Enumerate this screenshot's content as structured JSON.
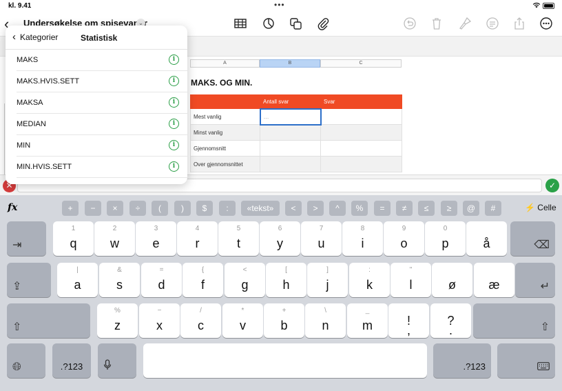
{
  "status": {
    "time": "kl. 9.41",
    "dots": "•••"
  },
  "toolbar": {
    "back_icon": "chevron-left-icon",
    "doc_title": "Undersøkelse om spisevaner",
    "title_chevron": "⌄",
    "icons": [
      "table-icon",
      "chart-icon",
      "shapes-icon",
      "paperclip-icon",
      "undo-icon",
      "delete-icon",
      "format-brush-icon",
      "comment-icon",
      "share-icon",
      "more-icon"
    ]
  },
  "popover": {
    "back_label": "Kategorier",
    "title": "Statistisk",
    "items": [
      "MAKS",
      "MAKS.HVIS.SETT",
      "MAKSA",
      "MEDIAN",
      "MIN",
      "MIN.HVIS.SETT"
    ]
  },
  "sheet": {
    "columns": [
      "A",
      "B",
      "C"
    ],
    "table_title": "MAKS. OG MIN.",
    "headers": [
      "",
      "Antall svar",
      "Svar"
    ],
    "rows": [
      {
        "label": "Mest vanlig",
        "b": "…",
        "c": ""
      },
      {
        "label": "Minst vanlig",
        "b": "",
        "c": ""
      },
      {
        "label": "Gjennomsnitt",
        "b": "",
        "c": ""
      },
      {
        "label": "Over gjennomsnittet",
        "b": "",
        "c": ""
      }
    ],
    "accent": "#f04a24"
  },
  "formula_bar": {
    "cancel": "✕",
    "ok": "✓"
  },
  "keyboard": {
    "fx": "fx",
    "symbols": [
      "+",
      "−",
      "×",
      "÷",
      "(",
      ")",
      "$",
      ":",
      "«tekst»",
      "<",
      ">",
      "^",
      "%",
      "=",
      "≠",
      "≤",
      "≥",
      "@",
      "#"
    ],
    "cell_label": "Celle",
    "row1": [
      {
        "sec": "1",
        "main": "q"
      },
      {
        "sec": "2",
        "main": "w"
      },
      {
        "sec": "3",
        "main": "e"
      },
      {
        "sec": "4",
        "main": "r"
      },
      {
        "sec": "5",
        "main": "t"
      },
      {
        "sec": "6",
        "main": "y"
      },
      {
        "sec": "7",
        "main": "u"
      },
      {
        "sec": "8",
        "main": "i"
      },
      {
        "sec": "9",
        "main": "o"
      },
      {
        "sec": "0",
        "main": "p"
      },
      {
        "sec": "",
        "main": "å"
      }
    ],
    "row2": [
      {
        "sec": "|",
        "main": "a"
      },
      {
        "sec": "&",
        "main": "s"
      },
      {
        "sec": "=",
        "main": "d"
      },
      {
        "sec": "{",
        "main": "f"
      },
      {
        "sec": "<",
        "main": "g"
      },
      {
        "sec": "[",
        "main": "h"
      },
      {
        "sec": "]",
        "main": "j"
      },
      {
        "sec": ":",
        "main": "k"
      },
      {
        "sec": "\"",
        "main": "l"
      },
      {
        "sec": "",
        "main": "ø"
      },
      {
        "sec": "",
        "main": "æ"
      }
    ],
    "row3": [
      {
        "sec": "%",
        "main": "z"
      },
      {
        "sec": "−",
        "main": "x"
      },
      {
        "sec": "/",
        "main": "c"
      },
      {
        "sec": "*",
        "main": "v"
      },
      {
        "sec": "+",
        "main": "b"
      },
      {
        "sec": "\\",
        "main": "n"
      },
      {
        "sec": "_",
        "main": "m"
      },
      {
        "sec": "",
        "main": "!\n,"
      },
      {
        "sec": "",
        "main": "?\n."
      }
    ],
    "numeric_label": ".?123"
  }
}
